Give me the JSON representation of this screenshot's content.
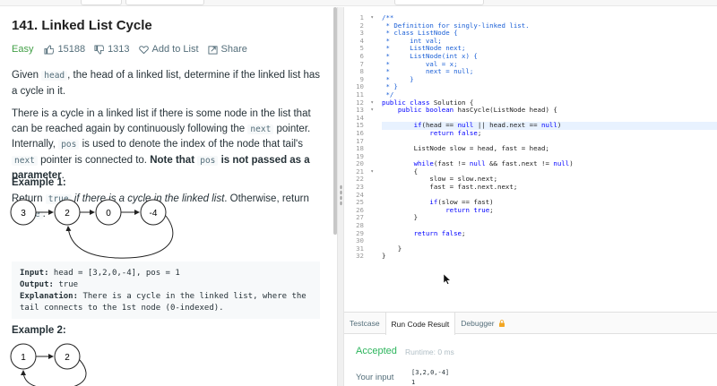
{
  "problem": {
    "title": "141. Linked List Cycle",
    "difficulty": "Easy",
    "likes": "15188",
    "dislikes": "1313",
    "add_to_list": "Add to List",
    "share": "Share"
  },
  "description": {
    "p1": [
      {
        "t": "Given "
      },
      {
        "c": "head"
      },
      {
        "t": ", the head of a linked list, determine if the linked list has a cycle in it."
      }
    ],
    "p2": [
      {
        "t": "There is a cycle in a linked list if there is some node in the list that can be reached again by continuously following the "
      },
      {
        "c": "next"
      },
      {
        "t": " pointer. Internally, "
      },
      {
        "c": "pos"
      },
      {
        "t": " is used to denote the index of the node that tail's "
      },
      {
        "c": "next"
      },
      {
        "t": " pointer is connected to. "
      },
      {
        "b": "Note that "
      },
      {
        "c": "pos"
      },
      {
        "b": " is not passed as a parameter"
      },
      {
        "t": "."
      }
    ],
    "p3": [
      {
        "t": "Return "
      },
      {
        "c": "true"
      },
      {
        "i": " if there is a cycle in the linked list"
      },
      {
        "t": ". Otherwise, return "
      },
      {
        "c": "false"
      },
      {
        "t": "."
      }
    ]
  },
  "example1": {
    "title": "Example 1:",
    "nodes": [
      "3",
      "2",
      "0",
      "-4"
    ],
    "input_label": "Input:",
    "input_value": " head = [3,2,0,-4], pos = 1",
    "output_label": "Output:",
    "output_value": " true",
    "explanation_label": "Explanation:",
    "explanation_value": " There is a cycle in the linked list, where the tail connects to the 1st node (0-indexed)."
  },
  "example2": {
    "title": "Example 2:",
    "nodes": [
      "1",
      "2"
    ]
  },
  "editor": {
    "lines": [
      [
        {
          "cmt": "/**"
        }
      ],
      [
        {
          "cmt": " * Definition for singly-linked list."
        }
      ],
      [
        {
          "cmt": " * class ListNode {"
        }
      ],
      [
        {
          "cmt": " *     int val;"
        }
      ],
      [
        {
          "cmt": " *     ListNode next;"
        }
      ],
      [
        {
          "cmt": " *     ListNode(int x) {"
        }
      ],
      [
        {
          "cmt": " *         val = x;"
        }
      ],
      [
        {
          "cmt": " *         next = null;"
        }
      ],
      [
        {
          "cmt": " *     }"
        }
      ],
      [
        {
          "cmt": " * }"
        }
      ],
      [
        {
          "cmt": " */"
        }
      ],
      [
        {
          "kw": "public class"
        },
        {
          "t": " Solution {"
        }
      ],
      [
        {
          "t": "    "
        },
        {
          "kw": "public boolean"
        },
        {
          "t": " hasCycle(ListNode head) {"
        }
      ],
      [],
      [
        {
          "t": "        "
        },
        {
          "kw": "if"
        },
        {
          "t": "(head == "
        },
        {
          "kw": "null"
        },
        {
          "t": " || head.next == "
        },
        {
          "kw": "null"
        },
        {
          "t": ")"
        }
      ],
      [
        {
          "t": "            "
        },
        {
          "kw": "return false"
        },
        {
          "t": ";"
        }
      ],
      [],
      [
        {
          "t": "        ListNode slow = head, fast = head;"
        }
      ],
      [],
      [
        {
          "t": "        "
        },
        {
          "kw": "while"
        },
        {
          "t": "(fast != "
        },
        {
          "kw": "null"
        },
        {
          "t": " && fast.next != "
        },
        {
          "kw": "null"
        },
        {
          "t": ")"
        }
      ],
      [
        {
          "t": "        {"
        }
      ],
      [
        {
          "t": "            slow = slow.next;"
        }
      ],
      [
        {
          "t": "            fast = fast.next.next;"
        }
      ],
      [],
      [
        {
          "t": "            "
        },
        {
          "kw": "if"
        },
        {
          "t": "(slow == fast)"
        }
      ],
      [
        {
          "t": "                "
        },
        {
          "kw": "return true"
        },
        {
          "t": ";"
        }
      ],
      [
        {
          "t": "        }"
        }
      ],
      [],
      [
        {
          "t": "        "
        },
        {
          "kw": "return false"
        },
        {
          "t": ";"
        }
      ],
      [],
      [
        {
          "t": "    }"
        }
      ],
      [
        {
          "t": "}"
        }
      ]
    ],
    "fold_lines": [
      1,
      12,
      13,
      21
    ],
    "active_line": 15
  },
  "console": {
    "tabs": [
      "Testcase",
      "Run Code Result",
      "Debugger"
    ],
    "active_tab": 1,
    "status": "Accepted",
    "runtime": "Runtime: 0 ms",
    "your_input_label": "Your input",
    "your_input_lines": [
      "[3,2,0,-4]",
      "1"
    ]
  },
  "colors": {
    "easy": "#43a047",
    "accepted": "#2db55d",
    "keyword": "#0000ff",
    "comment": "#1a5fd6"
  },
  "icons": {
    "like": "thumb-up-icon",
    "dislike": "thumb-down-icon",
    "add_to_list": "heart-icon",
    "share": "share-icon",
    "debugger": "lock-icon",
    "cursor": "mouse-pointer-icon"
  }
}
